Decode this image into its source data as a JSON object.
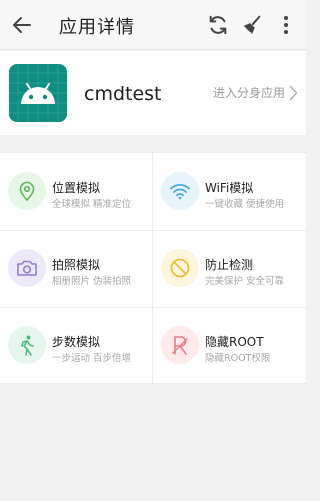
{
  "header": {
    "title": "应用详情",
    "back_icon": "arrow-left-icon",
    "icons": [
      "refresh-icon",
      "broom-icon",
      "more-vertical-icon"
    ]
  },
  "app": {
    "name": "cmdtest",
    "icon": "android-icon",
    "enter_label": "进入分身应用"
  },
  "features": [
    {
      "name": "位置模拟",
      "desc": "全球模拟 精准定位",
      "icon": "location-pin-icon",
      "bg": "#e7f6e7",
      "color": "#5cb85c"
    },
    {
      "name": "WiFi模拟",
      "desc": "一键收藏 便捷使用",
      "icon": "wifi-icon",
      "bg": "#e6f3fb",
      "color": "#4ea8dc"
    },
    {
      "name": "拍照模拟",
      "desc": "相册照片 伪装拍照",
      "icon": "camera-icon",
      "bg": "#ede9fa",
      "color": "#8f7fd6"
    },
    {
      "name": "防止检测",
      "desc": "完美保护 安全可靠",
      "icon": "block-icon",
      "bg": "#fdf6dc",
      "color": "#e9bf3a"
    },
    {
      "name": "步数模拟",
      "desc": "一步运动 百步倍增",
      "icon": "walking-icon",
      "bg": "#e6f6ee",
      "color": "#53b883"
    },
    {
      "name": "隐藏ROOT",
      "desc": "隐藏ROOT权限",
      "icon": "root-icon",
      "bg": "#fdeaea",
      "color": "#e47f86"
    }
  ],
  "colors": {
    "accent_android": "#3ddc84",
    "app_icon_bg": "#0f8d80"
  }
}
